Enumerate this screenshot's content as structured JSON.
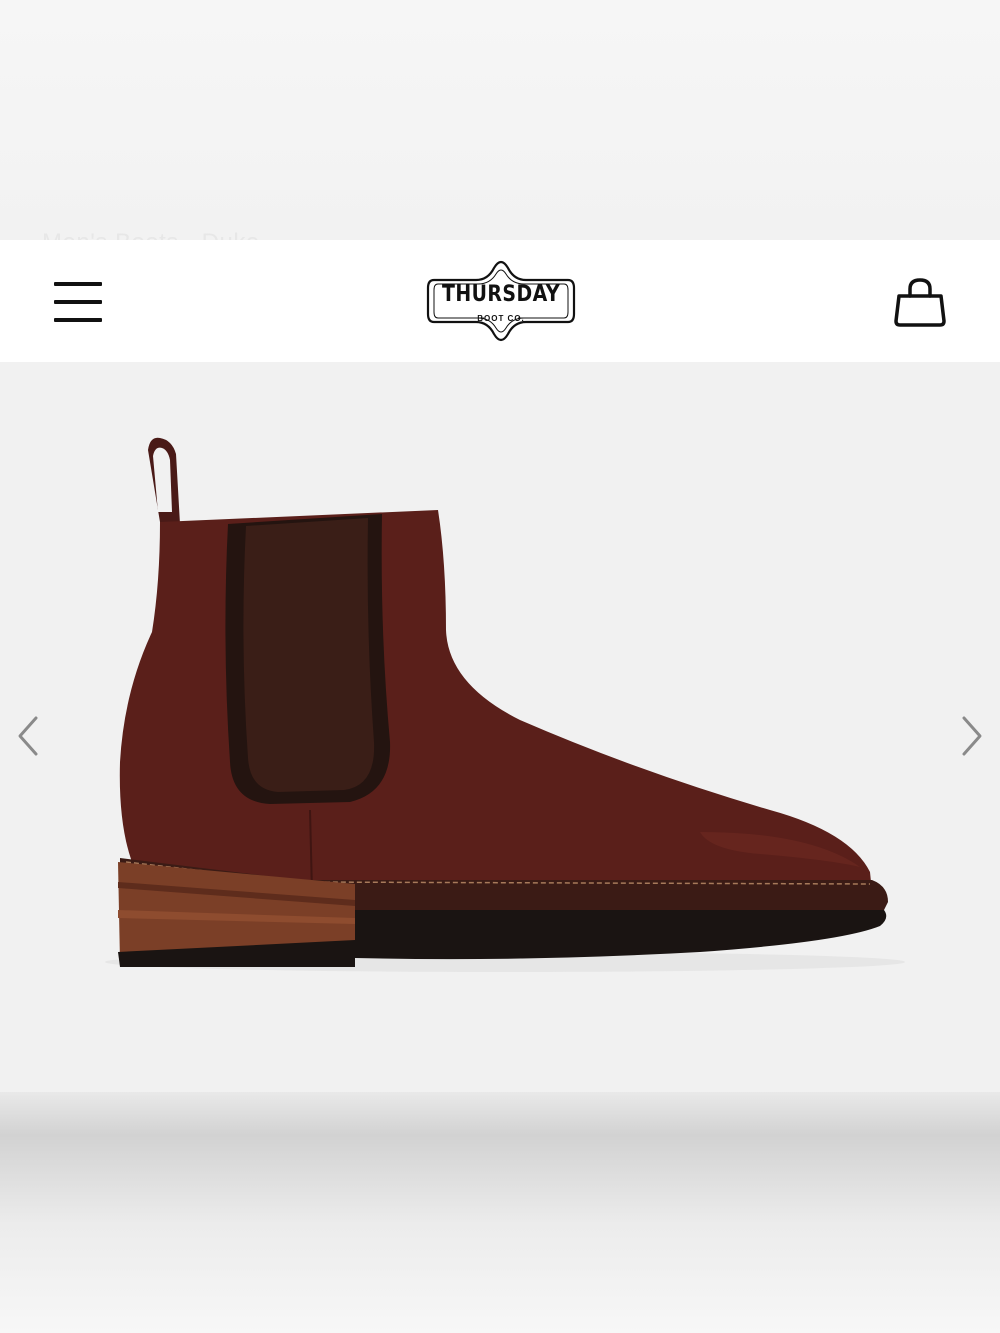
{
  "background": {
    "ghost_breadcrumb": "Men's Boots  ·  Duke"
  },
  "header": {
    "menu_icon": "hamburger-menu-icon",
    "logo": {
      "title": "THURSDAY",
      "subtitle": "BOOT CO."
    },
    "cart_icon": "shopping-bag-icon"
  },
  "gallery": {
    "image_subject": "chelsea-boot",
    "prev_icon": "chevron-left-icon",
    "next_icon": "chevron-right-icon"
  },
  "colors": {
    "leather": "#5a1f1a",
    "elastic": "#3a1e17",
    "sole": "#1a1412",
    "heel_stack": "#7b3f27",
    "header_bg": "#ffffff",
    "page_bg": "#f1f1f1"
  }
}
